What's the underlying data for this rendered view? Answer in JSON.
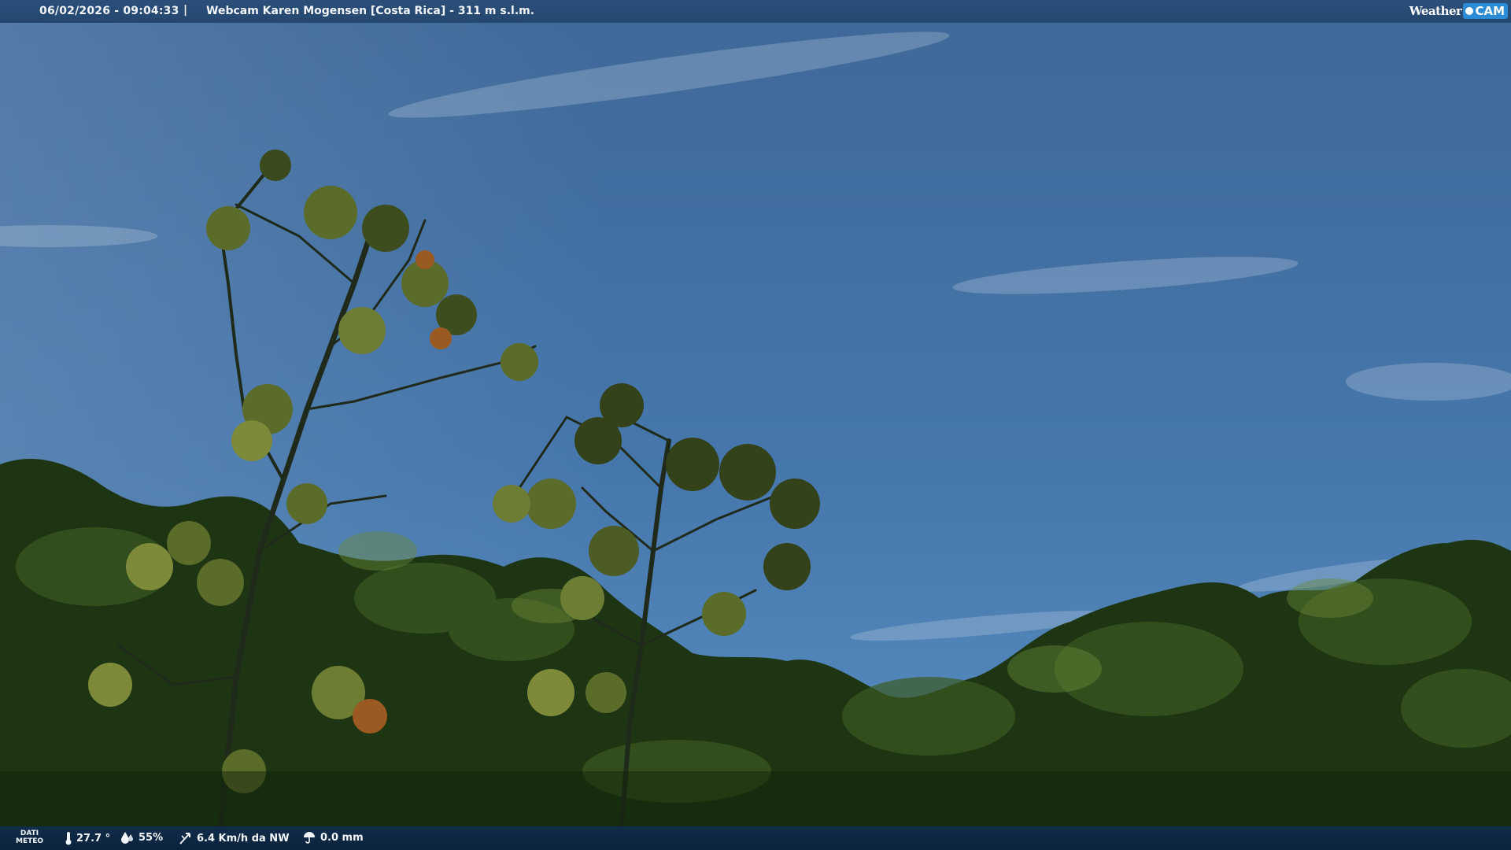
{
  "header": {
    "datetime": "06/02/2026 - 09:04:33",
    "separator": "|",
    "title": "Webcam Karen Mogensen [Costa Rica] - 311 m s.l.m.",
    "logo": {
      "word": "Weather",
      "badge": "CAM"
    }
  },
  "weather": {
    "label_line1": "DATI",
    "label_line2": "METEO",
    "temperature": "27.7 °",
    "humidity": "55%",
    "wind": "6.4 Km/h da NW",
    "rain": "0.0 mm",
    "icons": [
      "thermometer-icon",
      "humidity-drop-icon",
      "wind-icon",
      "rain-icon"
    ]
  },
  "colors": {
    "sky_top": "#3e6a98",
    "sky_bottom": "#4e86bb",
    "foliage": "#1f3a14",
    "bar": "#24476f"
  }
}
